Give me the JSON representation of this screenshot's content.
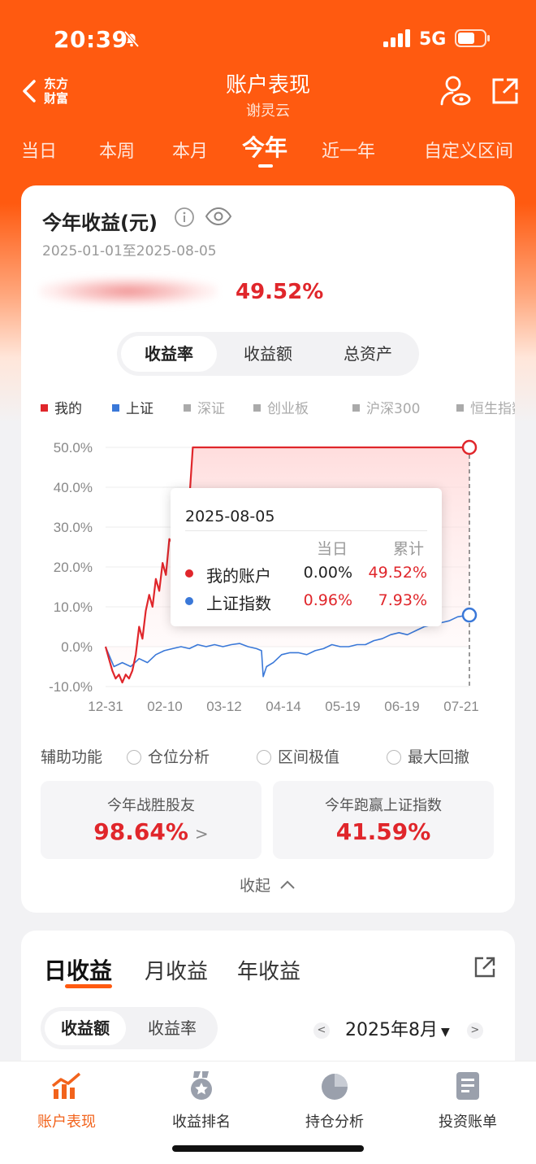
{
  "status_bar": {
    "time": "20:39",
    "network": "5G"
  },
  "header": {
    "logo_line1": "东方",
    "logo_line2": "财富",
    "title": "账户表现",
    "subtitle": "谢灵云"
  },
  "period_tabs": [
    {
      "label": "当日",
      "active": false
    },
    {
      "label": "本周",
      "active": false
    },
    {
      "label": "本月",
      "active": false
    },
    {
      "label": "今年",
      "active": true
    },
    {
      "label": "近一年",
      "active": false
    },
    {
      "label": "自定义区间",
      "active": false
    }
  ],
  "summary": {
    "title": "今年收益(元)",
    "date_range": "2025-01-01至2025-08-05",
    "return_pct": "49.52%"
  },
  "metric_tabs": [
    {
      "label": "收益率",
      "active": true
    },
    {
      "label": "收益额",
      "active": false
    },
    {
      "label": "总资产",
      "active": false
    }
  ],
  "legend": [
    {
      "label": "我的",
      "color": "#e0262b",
      "active": true
    },
    {
      "label": "上证",
      "color": "#3a78d8",
      "active": true
    },
    {
      "label": "深证",
      "color": "#aaaaaa",
      "active": false
    },
    {
      "label": "创业板",
      "color": "#aaaaaa",
      "active": false
    },
    {
      "label": "沪深300",
      "color": "#aaaaaa",
      "active": false
    },
    {
      "label": "恒生指数",
      "color": "#aaaaaa",
      "active": false
    }
  ],
  "chart_data": {
    "type": "line",
    "x_ticks": [
      "12-31",
      "02-10",
      "03-12",
      "04-14",
      "05-19",
      "06-19",
      "07-21"
    ],
    "y_ticks": [
      "50.0%",
      "40.0%",
      "30.0%",
      "20.0%",
      "10.0%",
      "0.0%",
      "-10.0%"
    ],
    "ylim": [
      -10,
      50
    ],
    "x_range_days": [
      0,
      217
    ],
    "series": [
      {
        "name": "我的",
        "color": "#e0262b",
        "points": [
          [
            0,
            0
          ],
          [
            2,
            -3
          ],
          [
            4,
            -6
          ],
          [
            6,
            -8
          ],
          [
            8,
            -7
          ],
          [
            10,
            -9
          ],
          [
            12,
            -7
          ],
          [
            14,
            -8
          ],
          [
            16,
            -6
          ],
          [
            18,
            -2
          ],
          [
            20,
            5
          ],
          [
            22,
            2
          ],
          [
            24,
            9
          ],
          [
            26,
            13
          ],
          [
            28,
            10
          ],
          [
            30,
            17
          ],
          [
            32,
            14
          ],
          [
            34,
            21
          ],
          [
            36,
            18
          ],
          [
            38,
            27
          ],
          [
            40,
            26
          ],
          [
            42,
            28
          ],
          [
            44,
            27
          ],
          [
            46,
            33
          ],
          [
            48,
            31
          ],
          [
            50,
            37
          ],
          [
            52,
            50
          ],
          [
            217,
            50
          ]
        ]
      },
      {
        "name": "上证",
        "color": "#3a78d8",
        "points": [
          [
            0,
            0
          ],
          [
            5,
            -5
          ],
          [
            10,
            -4
          ],
          [
            15,
            -5
          ],
          [
            20,
            -3
          ],
          [
            25,
            -4
          ],
          [
            30,
            -2
          ],
          [
            35,
            -1
          ],
          [
            40,
            -0.5
          ],
          [
            45,
            0
          ],
          [
            50,
            -0.5
          ],
          [
            55,
            0.5
          ],
          [
            60,
            0
          ],
          [
            65,
            0.5
          ],
          [
            70,
            0
          ],
          [
            75,
            0.5
          ],
          [
            80,
            0.8
          ],
          [
            85,
            0
          ],
          [
            90,
            -0.5
          ],
          [
            93,
            -1
          ],
          [
            94,
            -7.5
          ],
          [
            96,
            -5
          ],
          [
            100,
            -4
          ],
          [
            105,
            -2
          ],
          [
            110,
            -1.5
          ],
          [
            115,
            -1.5
          ],
          [
            120,
            -2
          ],
          [
            125,
            -1
          ],
          [
            130,
            -0.5
          ],
          [
            135,
            0.5
          ],
          [
            140,
            0
          ],
          [
            145,
            0
          ],
          [
            150,
            0.5
          ],
          [
            155,
            0.5
          ],
          [
            160,
            1.5
          ],
          [
            165,
            2
          ],
          [
            170,
            3
          ],
          [
            175,
            3.5
          ],
          [
            180,
            3
          ],
          [
            185,
            4
          ],
          [
            190,
            5
          ],
          [
            195,
            5.5
          ],
          [
            200,
            6
          ],
          [
            205,
            6.5
          ],
          [
            210,
            7.5
          ],
          [
            217,
            7.93
          ]
        ]
      }
    ]
  },
  "tooltip": {
    "date": "2025-08-05",
    "col_day": "当日",
    "col_total": "累计",
    "rows": [
      {
        "name": "我的账户",
        "day": "0.00%",
        "total": "49.52%",
        "dot": "#e0262b",
        "day_color": "#222222",
        "total_color": "#e0262b"
      },
      {
        "name": "上证指数",
        "day": "0.96%",
        "total": "7.93%",
        "dot": "#3a78d8",
        "day_color": "#e0262b",
        "total_color": "#e0262b"
      }
    ]
  },
  "aux": {
    "label": "辅助功能",
    "options": [
      "仓位分析",
      "区间极值",
      "最大回撤"
    ]
  },
  "stats": [
    {
      "label": "今年战胜股友",
      "value": "98.64%"
    },
    {
      "label": "今年跑赢上证指数",
      "value": "41.59%"
    }
  ],
  "collapse_label": "收起",
  "returns_tabs": [
    {
      "label": "日收益",
      "active": true
    },
    {
      "label": "月收益",
      "active": false
    },
    {
      "label": "年收益",
      "active": false
    }
  ],
  "returns_metric": [
    {
      "label": "收益额",
      "active": true
    },
    {
      "label": "收益率",
      "active": false
    }
  ],
  "month": "2025年8月",
  "bottom_nav": [
    {
      "label": "账户表现",
      "icon": "chart-trend-icon",
      "active": true
    },
    {
      "label": "收益排名",
      "icon": "medal-icon",
      "active": false
    },
    {
      "label": "持仓分析",
      "icon": "pie-chart-icon",
      "active": false
    },
    {
      "label": "投资账单",
      "icon": "document-icon",
      "active": false
    }
  ]
}
